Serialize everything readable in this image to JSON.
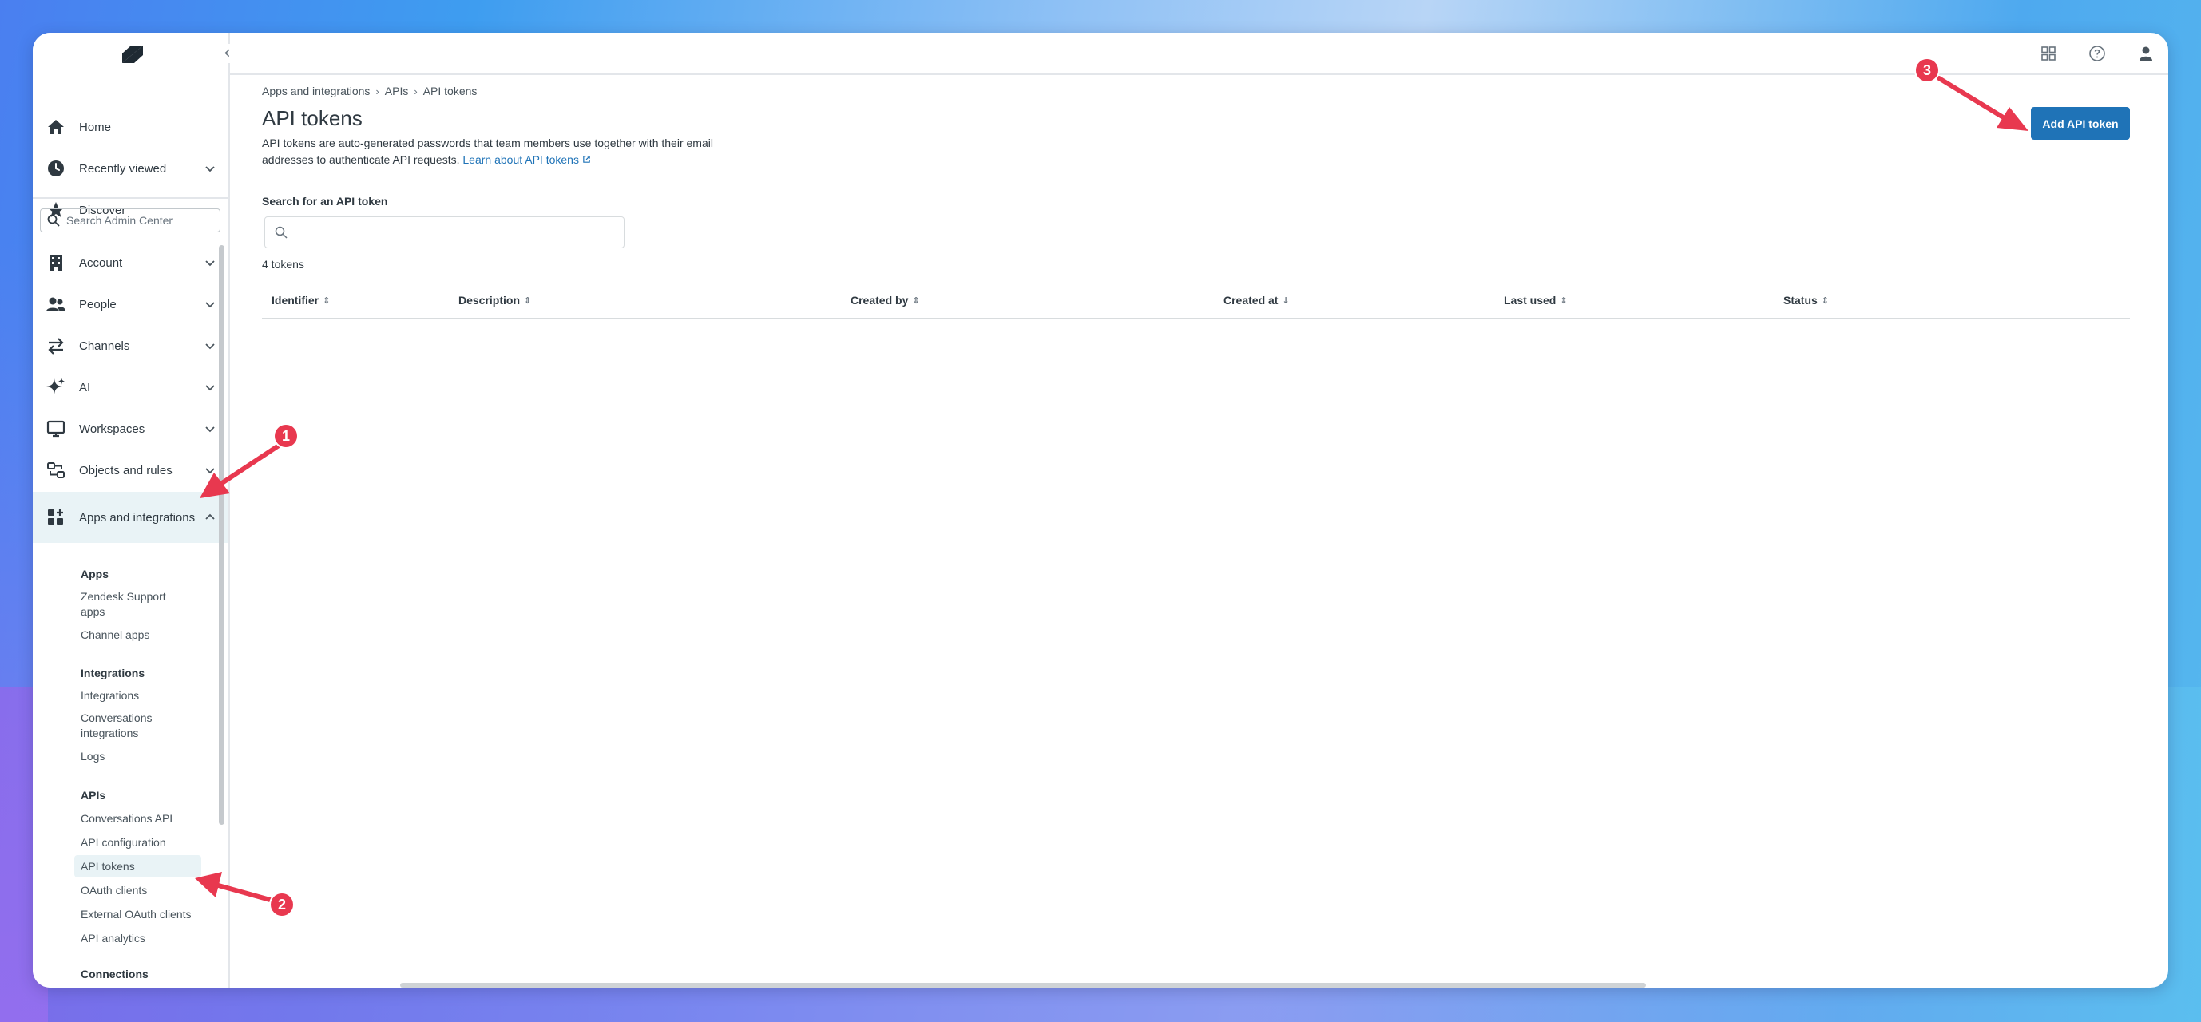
{
  "sidebar": {
    "logo": "zendesk-logo",
    "search_placeholder": "Search Admin Center",
    "items": [
      {
        "label": "Home",
        "icon": "home-icon"
      },
      {
        "label": "Recently viewed",
        "icon": "clock-icon"
      },
      {
        "label": "Discover",
        "icon": "star-icon"
      },
      {
        "label": "Account",
        "icon": "building-icon"
      },
      {
        "label": "People",
        "icon": "people-icon"
      },
      {
        "label": "Channels",
        "icon": "arrows-icon"
      },
      {
        "label": "AI",
        "icon": "sparkle-icon"
      },
      {
        "label": "Workspaces",
        "icon": "monitor-icon"
      },
      {
        "label": "Objects and rules",
        "icon": "objects-icon"
      },
      {
        "label": "Apps and integrations",
        "icon": "apps-icon"
      }
    ],
    "sub": {
      "apps_header": "Apps",
      "zendesk_support_apps": "Zendesk Support apps",
      "channel_apps": "Channel apps",
      "integrations_header": "Integrations",
      "integrations": "Integrations",
      "conversations_integrations": "Conversations integrations",
      "logs": "Logs",
      "apis_header": "APIs",
      "conversations_api": "Conversations API",
      "api_configuration": "API configuration",
      "api_tokens": "API tokens",
      "oauth_clients": "OAuth clients",
      "external_oauth_clients": "External OAuth clients",
      "api_analytics": "API analytics",
      "connections_header": "Connections"
    }
  },
  "breadcrumb": [
    "Apps and integrations",
    "APIs",
    "API tokens"
  ],
  "page": {
    "title": "API tokens",
    "description": "API tokens are auto-generated passwords that team members use together with their email addresses to authenticate API requests.",
    "learn_link": "Learn about API tokens",
    "add_button": "Add API token",
    "search_label": "Search for an API token",
    "token_count": "4 tokens"
  },
  "table": {
    "columns": [
      "Identifier",
      "Description",
      "Created by",
      "Created at",
      "Last used",
      "Status"
    ],
    "rows": []
  },
  "annotations": [
    "1",
    "2",
    "3"
  ],
  "colors": {
    "primary_blue": "#1f73b7",
    "active_bg": "#e9f3f6",
    "annotation_red": "#e8384f"
  }
}
